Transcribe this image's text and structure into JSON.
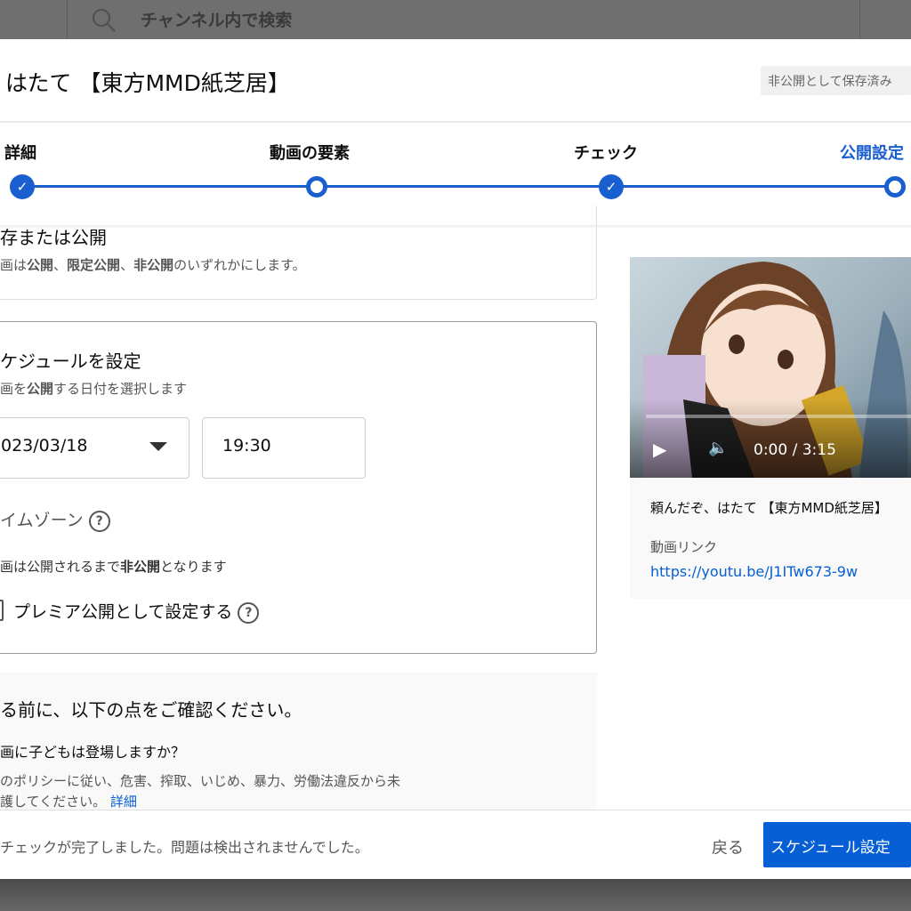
{
  "topbar": {
    "search_placeholder": "チャンネル内で検索"
  },
  "dialog": {
    "title": "はたて 【東方MMD紙芝居】",
    "save_label": "非公開として保存済み"
  },
  "stepper": {
    "steps": [
      {
        "label": "詳細",
        "state": "done"
      },
      {
        "label": "動画の要素",
        "state": "current"
      },
      {
        "label": "チェック",
        "state": "done"
      },
      {
        "label": "公開設定",
        "state": "active"
      }
    ]
  },
  "save_publish": {
    "heading": "存または公開",
    "desc_pre": "画は",
    "b1": "公開",
    "sep1": "、",
    "b2": "限定公開",
    "sep2": "、",
    "b3": "非公開",
    "desc_post": "のいずれかにします。"
  },
  "schedule": {
    "heading": "ケジュールを設定",
    "desc_pre": "画を",
    "desc_b": "公開",
    "desc_post": "する日付を選択します",
    "date": "023/03/18",
    "time": "19:30",
    "timezone_label": "イムゾーン",
    "note_pre": "画は公開されるまで",
    "note_b": "非公開",
    "note_post": "となります",
    "premiere_label": "プレミア公開として設定する"
  },
  "checklist": {
    "heading": "る前に、以下の点をご確認ください。",
    "question": "画に子どもは登場しますか？",
    "policy_line1": "のポリシーに従い、危害、搾取、いじめ、暴力、労働法違反から未",
    "policy_line2": "護してください。",
    "details_link": "詳細"
  },
  "footer": {
    "status": "チェックが完了しました。問題は検出されませんでした。",
    "back_label": "戻る",
    "schedule_label": "スケジュール設定"
  },
  "preview": {
    "time": "0:00 / 3:15",
    "video_title": "頼んだぞ、はたて 【東方MMD紙芝居】",
    "link_label": "動画リンク",
    "link": "https://youtu.be/J1ITw673-9w"
  },
  "colors": {
    "accent": "#065fd4",
    "step": "#1a5fd0"
  }
}
